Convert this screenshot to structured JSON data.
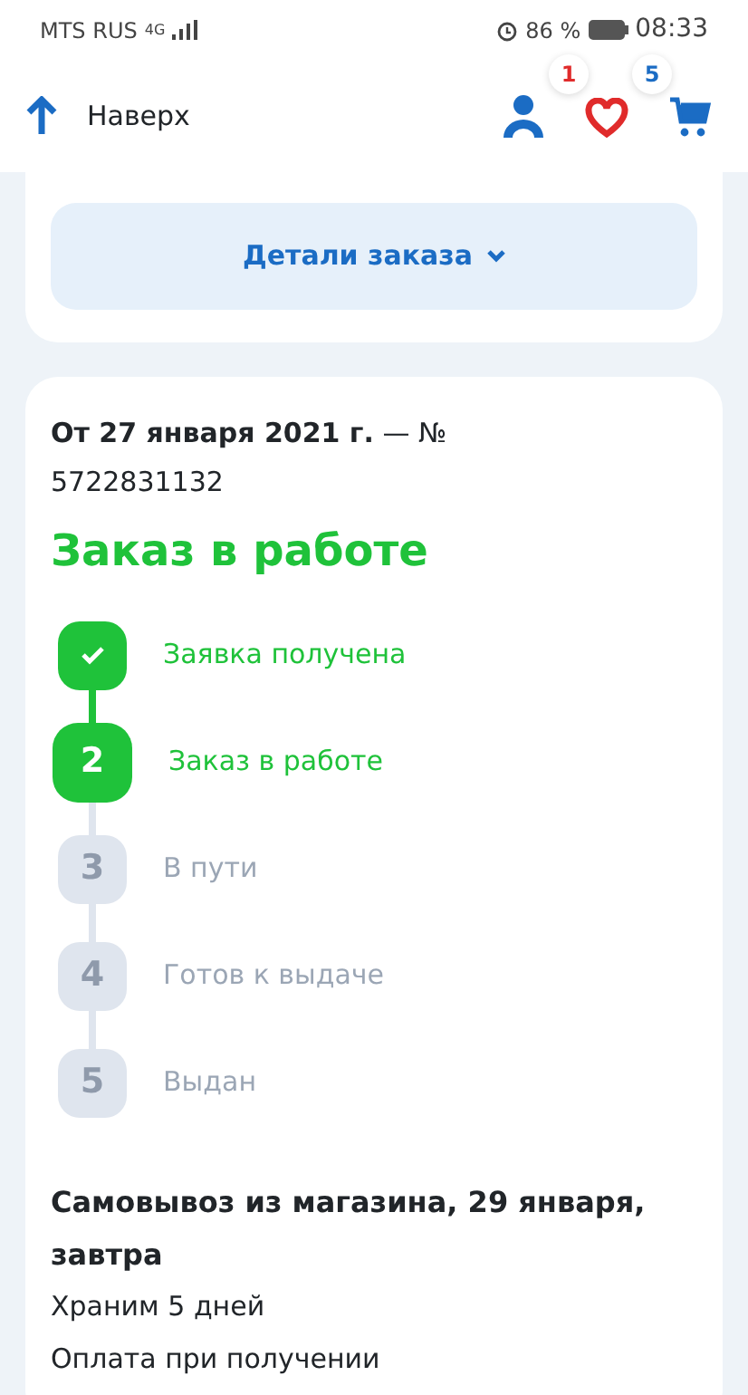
{
  "status_bar": {
    "carrier": "MTS RUS",
    "network": "4G",
    "battery": "86 %",
    "time": "08:33"
  },
  "header": {
    "back_to_top": "Наверх",
    "favorites_count": "1",
    "cart_count": "5"
  },
  "details_button": {
    "label": "Детали заказа"
  },
  "order": {
    "date": "От 27 января 2021 г.",
    "number_label": "— №",
    "number": "5722831132",
    "status": "Заказ в работе",
    "steps": [
      {
        "kind": "done",
        "label": "Заявка получена"
      },
      {
        "kind": "current",
        "number": "2",
        "label": "Заказ в работе"
      },
      {
        "kind": "pending",
        "number": "3",
        "label": "В пути"
      },
      {
        "kind": "pending",
        "number": "4",
        "label": "Готов к выдаче"
      },
      {
        "kind": "pending",
        "number": "5",
        "label": "Выдан"
      }
    ],
    "delivery": {
      "title": "Самовывоз из магазина, 29 января, завтра",
      "lines": [
        "Храним 5 дней",
        "Оплата при получении"
      ]
    }
  }
}
